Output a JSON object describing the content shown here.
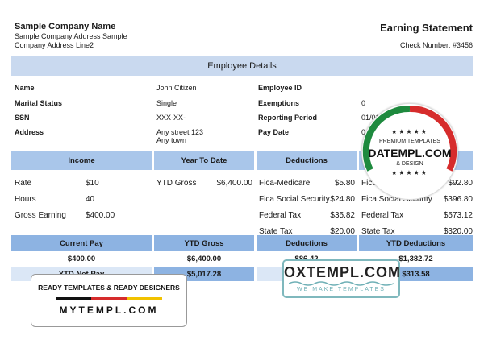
{
  "company": {
    "name": "Sample Company Name",
    "address1": "Sample Company Address Sample",
    "address2": "Company Address Line2"
  },
  "statement": {
    "title": "Earning Statement",
    "check_label": "Check Number: #3456"
  },
  "employee_section": {
    "title": "Employee Details",
    "left": [
      {
        "label": "Name",
        "value": "John Citizen"
      },
      {
        "label": "Marital Status",
        "value": "Single"
      },
      {
        "label": "SSN",
        "value": "XXX-XX-"
      },
      {
        "label": "Address",
        "value": "Any street 123",
        "value2": "Any town"
      }
    ],
    "right": [
      {
        "label": "Employee ID",
        "value": ""
      },
      {
        "label": "Exemptions",
        "value": "0"
      },
      {
        "label": "Reporting Period",
        "value": "01/01/2"
      },
      {
        "label": "Pay Date",
        "value": "04/"
      }
    ]
  },
  "table_headers": {
    "income": "Income",
    "ytd": "Year To Date",
    "deductions": "Deductions"
  },
  "income_rows": [
    {
      "label": "Rate",
      "value": "$10"
    },
    {
      "label": "Hours",
      "value": "40"
    },
    {
      "label": "Gross Earning",
      "value": "$400.00"
    }
  ],
  "ytd_rows": [
    {
      "label": "YTD Gross",
      "value": "$6,400.00"
    }
  ],
  "deduction_rows": [
    {
      "label": "Fica-Medicare",
      "value": "$5.80"
    },
    {
      "label": "Fica Social Security",
      "value": "$24.80"
    },
    {
      "label": "Federal Tax",
      "value": "$35.82"
    },
    {
      "label": "State Tax",
      "value": "$20.00"
    }
  ],
  "ytd_deduction_rows": [
    {
      "label": "Fica-M",
      "value": "$92.80"
    },
    {
      "label": "Fica Social Security",
      "value": "$396.80"
    },
    {
      "label": "Federal Tax",
      "value": "$573.12"
    },
    {
      "label": "State Tax",
      "value": "$320.00"
    }
  ],
  "summary": {
    "current_pay_label": "Current Pay",
    "current_pay_value": "$400.00",
    "ytd_gross_label": "YTD Gross",
    "ytd_gross_value": "$6,400.00",
    "deductions_label": "Deductions",
    "deductions_value": "$86.42",
    "ytd_deductions_label": "YTD Deductions",
    "ytd_deductions_value": "$1,382.72",
    "ytd_net_pay_label": "YTD Net Pay",
    "ytd_net_pay_value": "$5,017.28",
    "net_value": "$313.58"
  },
  "watermarks": {
    "badge_stars": "★★★★★",
    "badge_line1": "PREMIUM TEMPLATES",
    "badge_brand": "DATEMPL.COM",
    "badge_line3": "& DESIGN",
    "ox_brand": "OXTEMPL.COM",
    "ox_tagline": "WE MAKE TEMPLATES",
    "my_line1": "READY TEMPLATES & READY DESIGNERS",
    "my_brand": "MYTEMPL.COM"
  },
  "colors": {
    "header_bar": "#c9d9ef",
    "section_header": "#a9c6ea",
    "summary_header": "#8db3e2",
    "badge_green": "#1e8a3e",
    "badge_red": "#d62c2c",
    "ox_teal": "#6fb0b6"
  }
}
